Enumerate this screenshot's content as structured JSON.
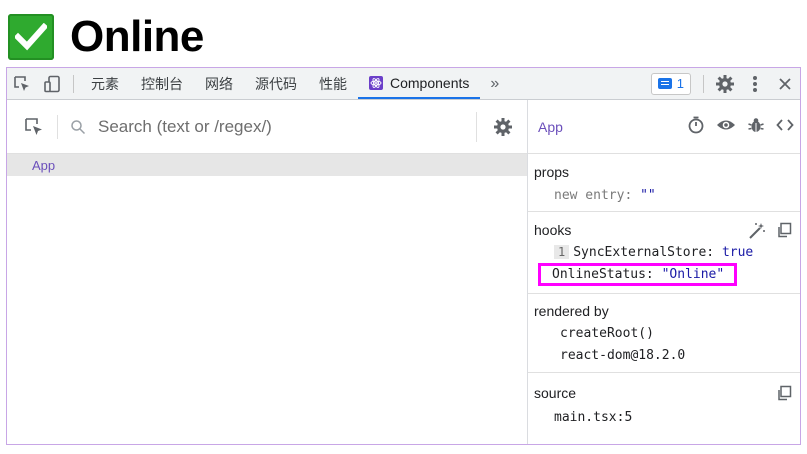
{
  "header": {
    "title": "Online",
    "check_icon": "green-check-icon"
  },
  "devtools": {
    "tabs": [
      {
        "label": "元素"
      },
      {
        "label": "控制台"
      },
      {
        "label": "网络"
      },
      {
        "label": "源代码"
      },
      {
        "label": "性能"
      },
      {
        "label": "Components"
      }
    ],
    "more_tabs": "»",
    "issues_count": "1",
    "accent_color": "#1a73e8"
  },
  "left": {
    "search_placeholder": "Search (text or /regex/)",
    "tree": [
      {
        "label": "App"
      }
    ]
  },
  "right": {
    "component_name": "App",
    "props": {
      "title": "props",
      "items": [
        {
          "key": "new entry",
          "value": "\"\""
        }
      ]
    },
    "hooks": {
      "title": "hooks",
      "items": [
        {
          "index": "1",
          "name": "SyncExternalStore",
          "value": "true"
        },
        {
          "name": "OnlineStatus",
          "value": "\"Online\""
        }
      ],
      "highlight_color": "#ff00ff"
    },
    "rendered_by": {
      "title": "rendered by",
      "items": [
        "createRoot()",
        "react-dom@18.2.0"
      ]
    },
    "source": {
      "title": "source",
      "file": "main.tsx:5"
    }
  }
}
